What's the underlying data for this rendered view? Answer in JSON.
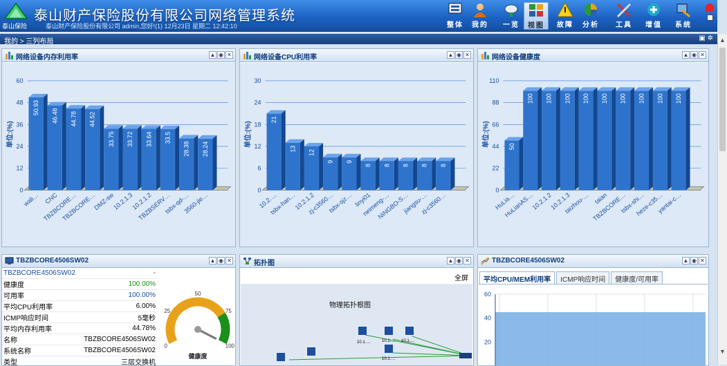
{
  "app": {
    "logo_caption": "泰山保险",
    "title": "泰山财产保险股份有限公司网络管理系统",
    "subtitle": "泰山财产保险股份有限公司 admin,您好!(1) 12月23日 星期二 12:42:10"
  },
  "nav": [
    {
      "label": "整体",
      "icon": "overview-icon"
    },
    {
      "label": "我的",
      "icon": "user-icon"
    },
    {
      "label": "一览",
      "icon": "satellite-dish-icon"
    },
    {
      "label": "视图",
      "icon": "view-grid-icon",
      "active": true
    },
    {
      "label": "故障",
      "icon": "warning-icon"
    },
    {
      "label": "分析",
      "icon": "pie-chart-icon"
    },
    {
      "label": "工具",
      "icon": "tools-icon"
    },
    {
      "label": "增值",
      "icon": "plus-circle-icon"
    },
    {
      "label": "系统",
      "icon": "system-icon"
    }
  ],
  "breadcrumb": "我的 > 三列布局",
  "panels": {
    "mem": {
      "title": "网络设备内存利用率"
    },
    "cpu": {
      "title": "网络设备CPU利用率"
    },
    "health": {
      "title": "网络设备健康度"
    },
    "detail": {
      "title": "TBZBCORE4506SW02",
      "rows": [
        [
          "TBZBCORE4506SW02",
          "-"
        ],
        [
          "健康度",
          "100.00%"
        ],
        [
          "可用率",
          "100.00%"
        ],
        [
          "平均CPU利用率",
          "6.00%"
        ],
        [
          "ICMP响应时间",
          "5毫秒"
        ],
        [
          "平均内存利用率",
          "44.78%"
        ],
        [
          "名称",
          "TBZBCORE4506SW02"
        ],
        [
          "系统名称",
          "TBZBCORE4506SW02"
        ],
        [
          "类型",
          "三层交换机"
        ]
      ],
      "gauge_label": "健康度",
      "gauge_value": 100,
      "gauge_ticks": [
        "0",
        "25",
        "50",
        "75",
        "100"
      ]
    },
    "topo": {
      "title": "拓扑图",
      "fullscreen": "全屏",
      "canvas_title": "物理拓扑根图",
      "node_labels": [
        "10.1.…",
        "10.1.…",
        "10.1.…",
        "10.1.…"
      ]
    },
    "trend": {
      "title": "TBZBCORE4506SW02",
      "tabs": [
        "平均CPU/MEM利用率",
        "ICMP响应时间",
        "健康度/可用率"
      ],
      "yticks": [
        "60",
        "40",
        "20"
      ]
    }
  },
  "chart_data": [
    {
      "type": "bar",
      "ylabel": "单位:(%)",
      "ylim": [
        0,
        60
      ],
      "yticks": [
        0,
        12,
        24,
        36,
        48,
        60
      ],
      "categories": [
        "wali…",
        "CNC",
        "TBZBCORE…",
        "TBZBCORE…",
        "DMZ-sw",
        "10.2.1.3",
        "10.2.1.2",
        "TBZBSERV…",
        "tsbx-qd-…",
        "3560-jie…"
      ],
      "values": [
        50.93,
        46.48,
        44.78,
        44.52,
        33.75,
        33.72,
        33.64,
        33.5,
        28.38,
        28.24
      ],
      "labels": [
        "50.93",
        "46.48",
        "44.78",
        "44.52",
        "33.75",
        "33.72",
        "33.64",
        "33.5",
        "28.38",
        "28.24"
      ]
    },
    {
      "type": "bar",
      "ylabel": "单位:(%)",
      "ylim": [
        0,
        30
      ],
      "yticks": [
        0,
        6,
        12,
        18,
        24,
        30
      ],
      "categories": [
        "10.2.…",
        "tsbx-han…",
        "10.2.1.2",
        "zj-c3560…",
        "tsbx-sjz…",
        "linyi01",
        "neimeng-…",
        "NINGBO-S…",
        "jiangsu-…",
        "zj-c3560…"
      ],
      "values": [
        21,
        13,
        12,
        9,
        9,
        8,
        8,
        8,
        8,
        8
      ],
      "labels": [
        "21",
        "13",
        "12",
        "9",
        "9",
        "8",
        "8",
        "8",
        "8",
        "8"
      ]
    },
    {
      "type": "bar",
      "ylabel": "单位:(%)",
      "ylim": [
        0,
        110
      ],
      "yticks": [
        0,
        22,
        44,
        66,
        88,
        110
      ],
      "categories": [
        "HuLia…",
        "HuLianAS…",
        "10.2.1.2",
        "10.2.1.3",
        "taizhou-…",
        "taian",
        "TBZBCORE…",
        "tsbx-shi…",
        "heze-c35…",
        "yantai-c…"
      ],
      "values": [
        50,
        100,
        100,
        100,
        100,
        100,
        100,
        100,
        100,
        100
      ],
      "labels": [
        "50",
        "100",
        "100",
        "100",
        "100",
        "100",
        "100",
        "100",
        "100",
        "100"
      ]
    },
    {
      "type": "area",
      "ylim": [
        0,
        60
      ],
      "yticks": [
        20,
        40,
        60
      ],
      "values": [
        45
      ]
    }
  ],
  "colors": {
    "bar_front": "#2f74cc",
    "bar_side": "#14478f",
    "bar_top": "#6aa3ea",
    "grid": "#3a7bd5",
    "health": "#1a8f1a"
  }
}
